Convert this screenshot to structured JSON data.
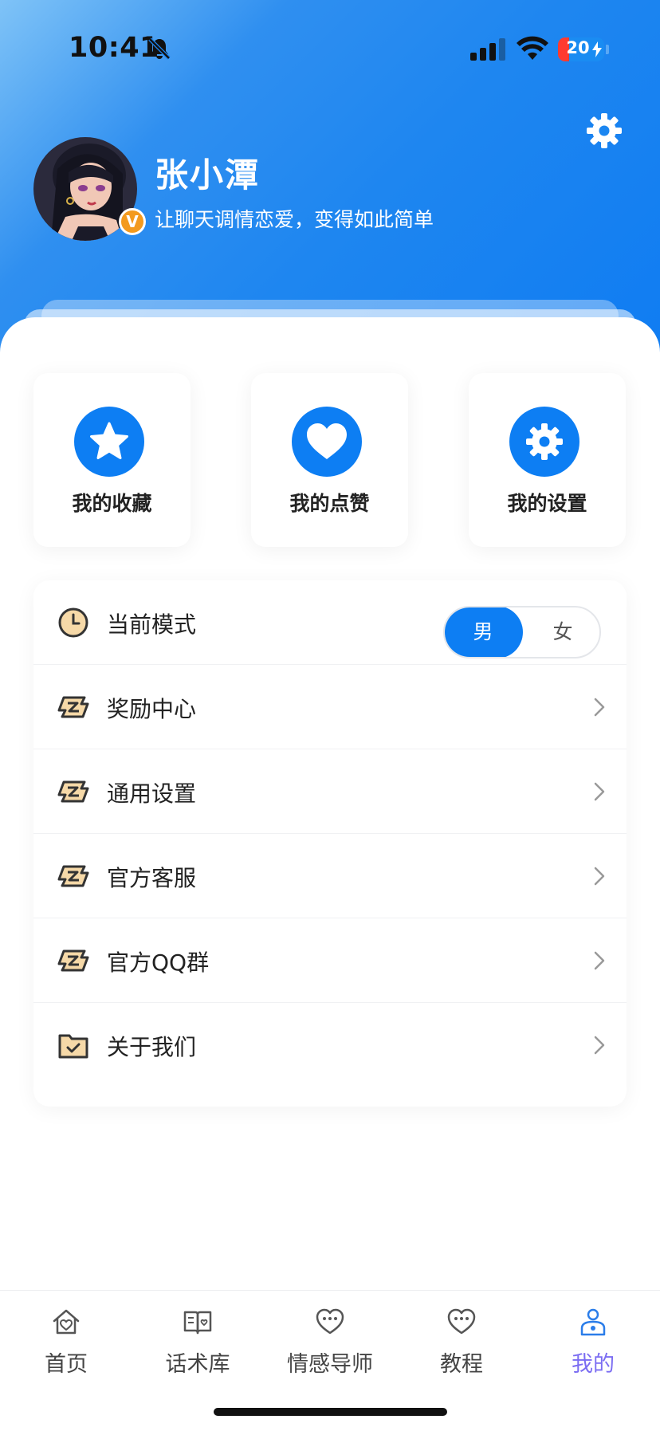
{
  "status_bar": {
    "time": "10:41",
    "battery_level": "20",
    "icons": [
      "bell-slash-icon",
      "signal-icon",
      "wifi-icon",
      "battery-icon"
    ]
  },
  "header": {
    "settings_icon": "gear-icon",
    "gradient_colors": [
      "#7fc3f7",
      "#1e86f0",
      "#0f7cf2"
    ]
  },
  "profile": {
    "name": "张小潭",
    "slogan": "让聊天调情恋爱，变得如此简单",
    "badge": "V",
    "badge_color": "#f39a1e"
  },
  "quick_actions": [
    {
      "label": "我的收藏",
      "icon": "star-icon"
    },
    {
      "label": "我的点赞",
      "icon": "heart-icon"
    },
    {
      "label": "我的设置",
      "icon": "gear-icon"
    }
  ],
  "menu": {
    "mode": {
      "label": "当前模式",
      "icon": "clock-icon",
      "options": [
        "男",
        "女"
      ],
      "selected": "男"
    },
    "items": [
      {
        "label": "奖励中心",
        "icon": "ticket-icon"
      },
      {
        "label": "通用设置",
        "icon": "ticket-icon"
      },
      {
        "label": "官方客服",
        "icon": "ticket-icon"
      },
      {
        "label": "官方QQ群",
        "icon": "ticket-icon"
      },
      {
        "label": "关于我们",
        "icon": "folder-check-icon"
      }
    ]
  },
  "tab_bar": {
    "tabs": [
      {
        "label": "首页",
        "icon": "home-heart-icon"
      },
      {
        "label": "话术库",
        "icon": "book-icon"
      },
      {
        "label": "情感导师",
        "icon": "chat-heart-icon"
      },
      {
        "label": "教程",
        "icon": "chat-heart-icon"
      },
      {
        "label": "我的",
        "icon": "user-icon"
      }
    ],
    "active": "我的",
    "active_color": "#7b6df2"
  },
  "colors": {
    "accent": "#0d7ef3",
    "menu_icon_fill": "#f6d9a8"
  }
}
